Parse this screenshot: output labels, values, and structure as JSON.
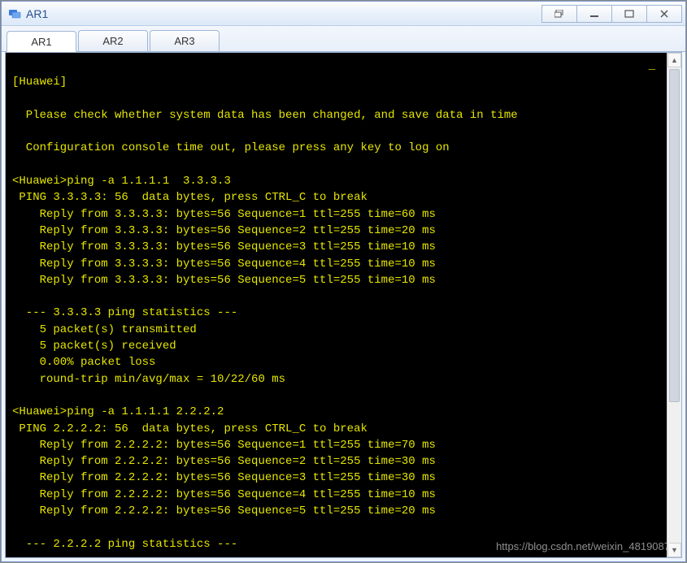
{
  "window": {
    "title": "AR1"
  },
  "tabs": [
    {
      "label": "AR1",
      "active": true
    },
    {
      "label": "AR2",
      "active": false
    },
    {
      "label": "AR3",
      "active": false
    }
  ],
  "terminal": {
    "lines": [
      "[Huawei]",
      "",
      "  Please check whether system data has been changed, and save data in time",
      "",
      "  Configuration console time out, please press any key to log on",
      "",
      "<Huawei>ping -a 1.1.1.1  3.3.3.3",
      " PING 3.3.3.3: 56  data bytes, press CTRL_C to break",
      "    Reply from 3.3.3.3: bytes=56 Sequence=1 ttl=255 time=60 ms",
      "    Reply from 3.3.3.3: bytes=56 Sequence=2 ttl=255 time=20 ms",
      "    Reply from 3.3.3.3: bytes=56 Sequence=3 ttl=255 time=10 ms",
      "    Reply from 3.3.3.3: bytes=56 Sequence=4 ttl=255 time=10 ms",
      "    Reply from 3.3.3.3: bytes=56 Sequence=5 ttl=255 time=10 ms",
      "",
      "  --- 3.3.3.3 ping statistics ---",
      "    5 packet(s) transmitted",
      "    5 packet(s) received",
      "    0.00% packet loss",
      "    round-trip min/avg/max = 10/22/60 ms",
      "",
      "<Huawei>ping -a 1.1.1.1 2.2.2.2",
      " PING 2.2.2.2: 56  data bytes, press CTRL_C to break",
      "    Reply from 2.2.2.2: bytes=56 Sequence=1 ttl=255 time=70 ms",
      "    Reply from 2.2.2.2: bytes=56 Sequence=2 ttl=255 time=30 ms",
      "    Reply from 2.2.2.2: bytes=56 Sequence=3 ttl=255 time=30 ms",
      "    Reply from 2.2.2.2: bytes=56 Sequence=4 ttl=255 time=10 ms",
      "    Reply from 2.2.2.2: bytes=56 Sequence=5 ttl=255 time=20 ms",
      "",
      "  --- 2.2.2.2 ping statistics ---"
    ]
  },
  "watermark": "https://blog.csdn.net/weixin_4819087"
}
